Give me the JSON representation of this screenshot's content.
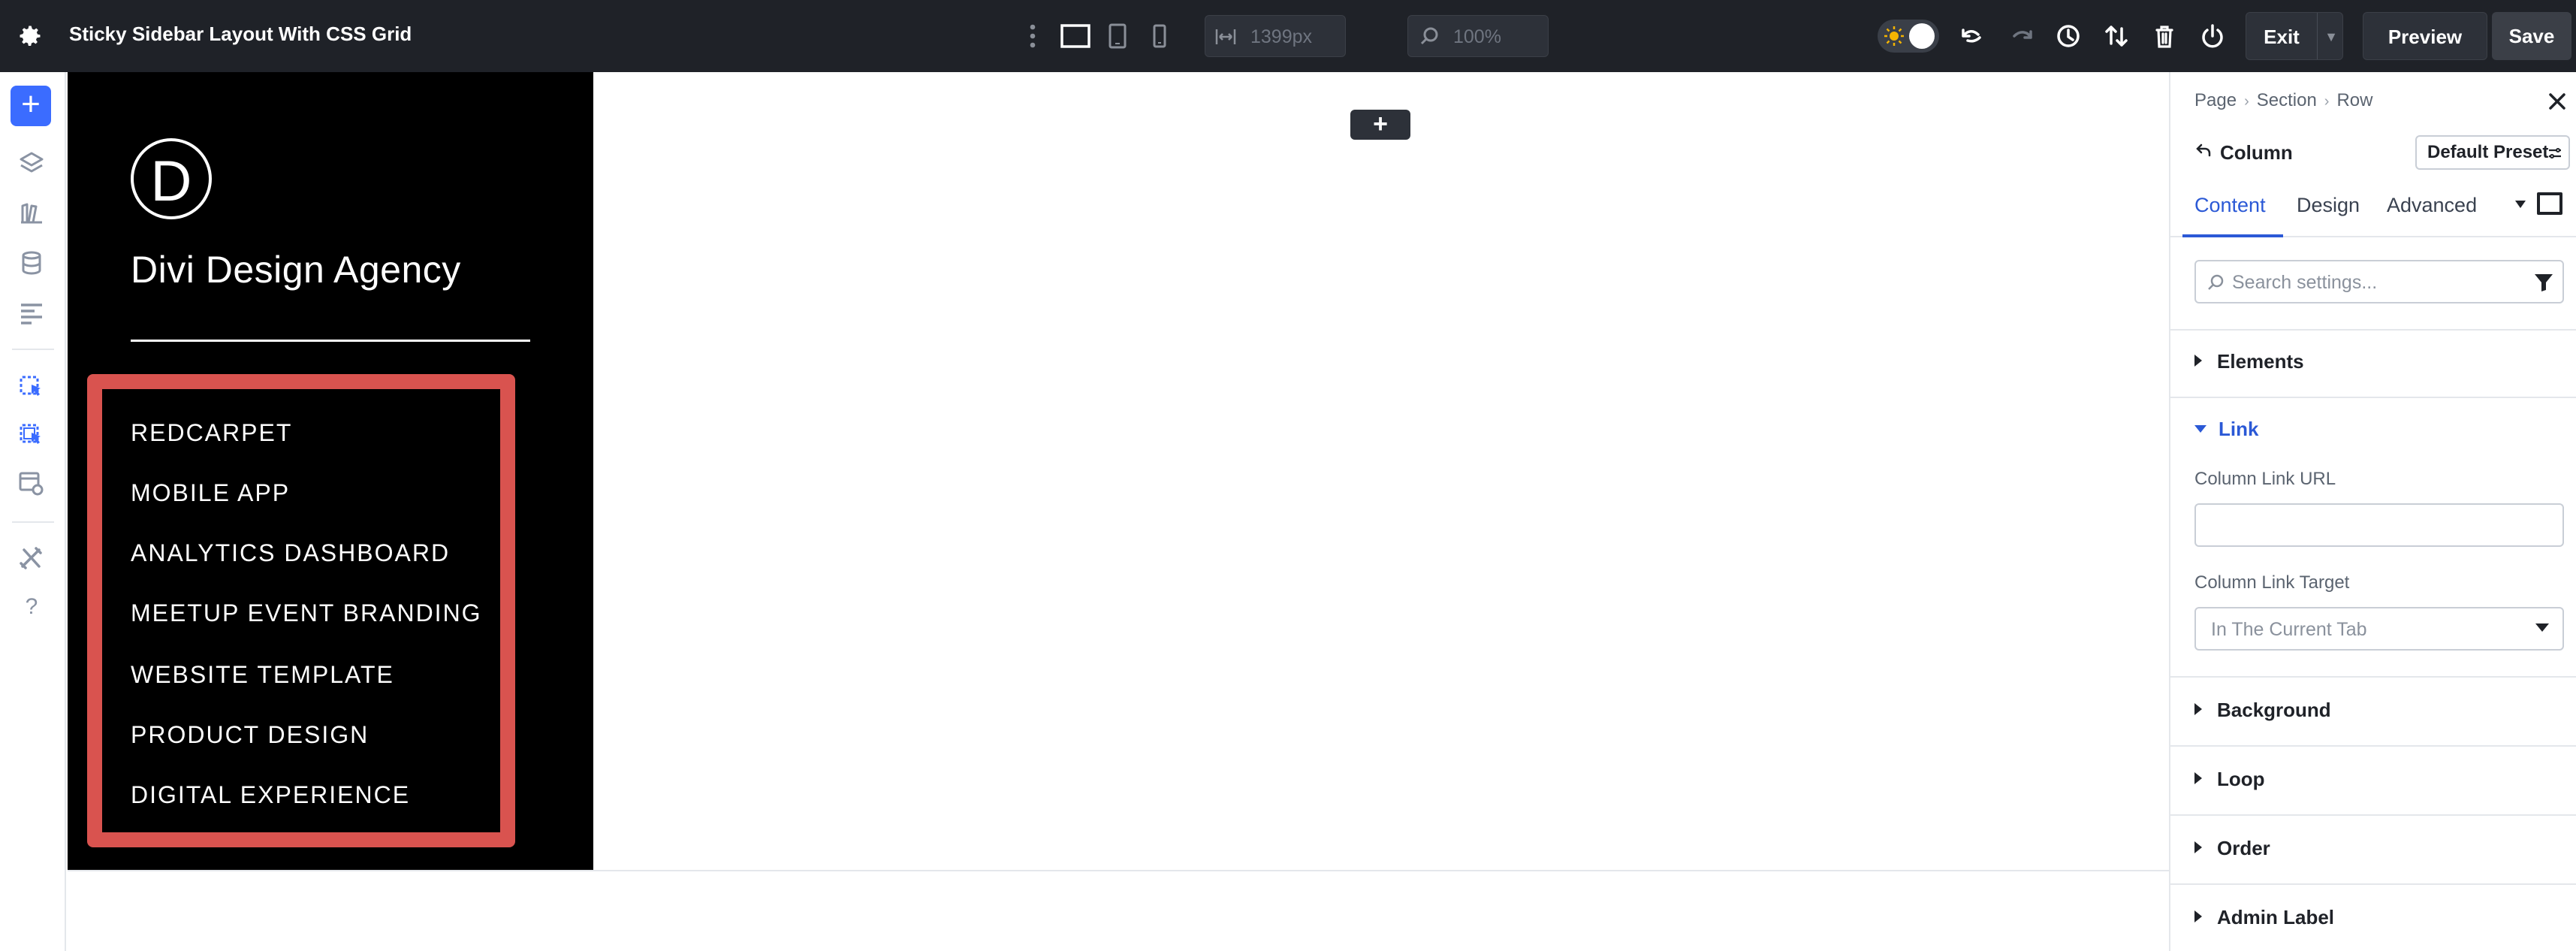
{
  "topbar": {
    "title": "Sticky Sidebar Layout With CSS Grid",
    "width_value": "1399px",
    "zoom_value": "100%",
    "exit_label": "Exit",
    "preview_label": "Preview",
    "save_label": "Save"
  },
  "canvas": {
    "logo_letter": "D",
    "agency_name": "Divi Design Agency",
    "menu": [
      "REDCARPET",
      "MOBILE APP",
      "ANALYTICS DASHBOARD",
      "MEETUP EVENT BRANDING",
      "WEBSITE TEMPLATE",
      "PRODUCT DESIGN",
      "DIGITAL EXPERIENCE"
    ],
    "add_symbol": "+"
  },
  "panel": {
    "breadcrumb": [
      "Page",
      "Section",
      "Row"
    ],
    "element_title": "Column",
    "preset_label": "Default Preset",
    "tabs": [
      "Content",
      "Design",
      "Advanced"
    ],
    "active_tab": "Content",
    "search_placeholder": "Search settings...",
    "sections": {
      "elements": "Elements",
      "link": "Link",
      "background": "Background",
      "loop": "Loop",
      "order": "Order",
      "admin_label": "Admin Label"
    },
    "link_fields": {
      "url_label": "Column Link URL",
      "url_value": "",
      "target_label": "Column Link Target",
      "target_value": "In The Current Tab"
    }
  },
  "colors": {
    "topbar_bg": "#1f2228",
    "accent_blue": "#3b6cff",
    "tab_active": "#2b59d6",
    "menu_border_red": "#d9534f",
    "sidebar_bg": "#000000"
  }
}
